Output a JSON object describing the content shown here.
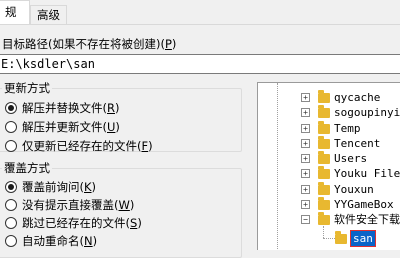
{
  "tabs": [
    {
      "label": "规"
    },
    {
      "label": "高级"
    }
  ],
  "destination": {
    "label": "目标路径(如果不存在将被创建)(",
    "mnemonic": "P",
    "label_end": ")",
    "value": "E:\\ksdler\\san"
  },
  "update_mode": {
    "title": "更新方式",
    "options": [
      {
        "text": "解压并替换文件(",
        "mnemonic": "R",
        "end": ")",
        "selected": true
      },
      {
        "text": "解压并更新文件(",
        "mnemonic": "U",
        "end": ")",
        "selected": false
      },
      {
        "text": "仅更新已经存在的文件(",
        "mnemonic": "F",
        "end": ")",
        "selected": false
      }
    ]
  },
  "overwrite_mode": {
    "title": "覆盖方式",
    "options": [
      {
        "text": "覆盖前询问(",
        "mnemonic": "K",
        "end": ")",
        "selected": true
      },
      {
        "text": "没有提示直接覆盖(",
        "mnemonic": "W",
        "end": ")",
        "selected": false
      },
      {
        "text": "跳过已经存在的文件(",
        "mnemonic": "S",
        "end": ")",
        "selected": false
      },
      {
        "text": "自动重命名(",
        "mnemonic": "N",
        "end": ")",
        "selected": false
      }
    ]
  },
  "folder_tree": {
    "items": [
      {
        "label": "qycache"
      },
      {
        "label": "sogoupinyin"
      },
      {
        "label": "Temp"
      },
      {
        "label": "Tencent"
      },
      {
        "label": "Users"
      },
      {
        "label": "Youku Files"
      },
      {
        "label": "Youxun"
      },
      {
        "label": "YYGameBox"
      },
      {
        "label": "软件安全下载"
      }
    ],
    "selected_child": "san"
  },
  "colors": {
    "folder": "#e8b830",
    "selection": "#0a64c8",
    "selection_border": "#e03030"
  }
}
